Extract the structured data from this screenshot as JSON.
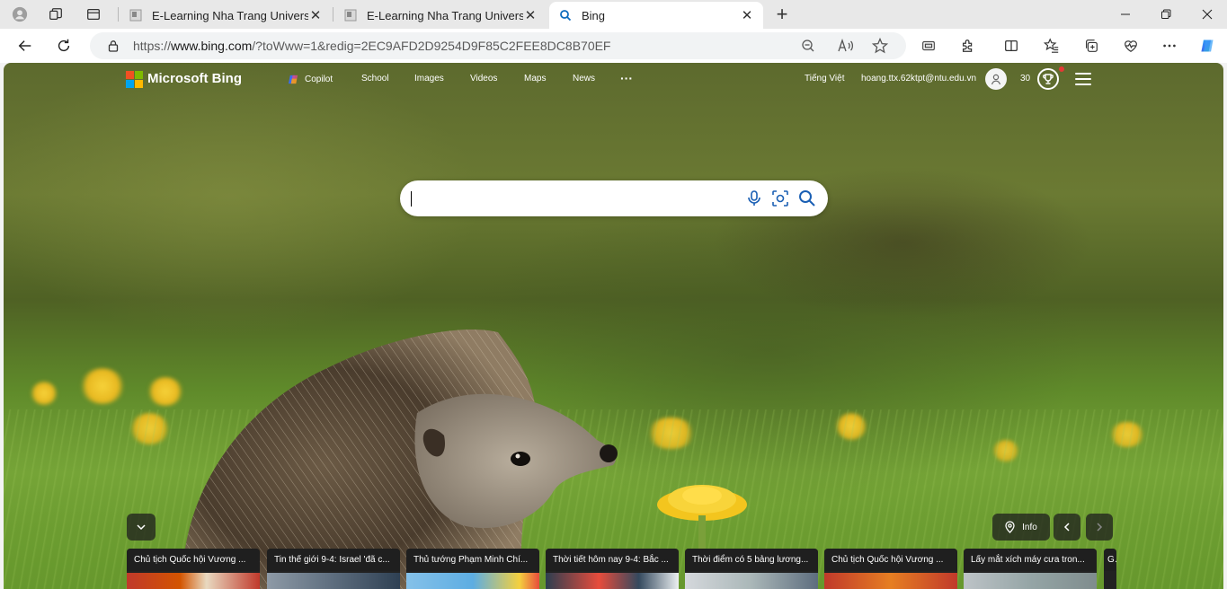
{
  "browser": {
    "tabs": [
      {
        "title": "E-Learning Nha Trang University",
        "active": false
      },
      {
        "title": "E-Learning Nha Trang University",
        "active": false
      },
      {
        "title": "Bing",
        "active": true
      }
    ],
    "url_prefix": "https://",
    "url_host": "www.bing.com",
    "url_rest": "/?toWww=1&redig=2EC9AFD2D9254D9F85C2FEE8DC8B70EF"
  },
  "bing": {
    "brand": "Microsoft Bing",
    "nav": [
      "Copilot",
      "School",
      "Images",
      "Videos",
      "Maps",
      "News",
      "···"
    ],
    "language": "Tiếng Việt",
    "user_email": "hoang.ttx.62ktpt@ntu.edu.vn",
    "points": "30",
    "search_placeholder": "",
    "info_label": "Info"
  },
  "news": [
    "Chủ tịch Quốc hội Vương ...",
    "Tin thế giới 9-4: Israel 'đã c...",
    "Thủ tướng Phạm Minh Chí...",
    "Thời tiết hôm nay 9-4: Bắc ...",
    "Thời điểm có 5 bảng lương...",
    "Chủ tịch Quốc hội Vương ...",
    "Lấy mắt xích máy cưa tron...",
    "G"
  ],
  "colors": {
    "ms_red": "#f25022",
    "ms_green": "#7fba00",
    "ms_blue": "#00a4ef",
    "ms_yellow": "#ffb900",
    "edge_accent": "#0f6cbd",
    "search_icon_blue": "#1a5fb4"
  }
}
